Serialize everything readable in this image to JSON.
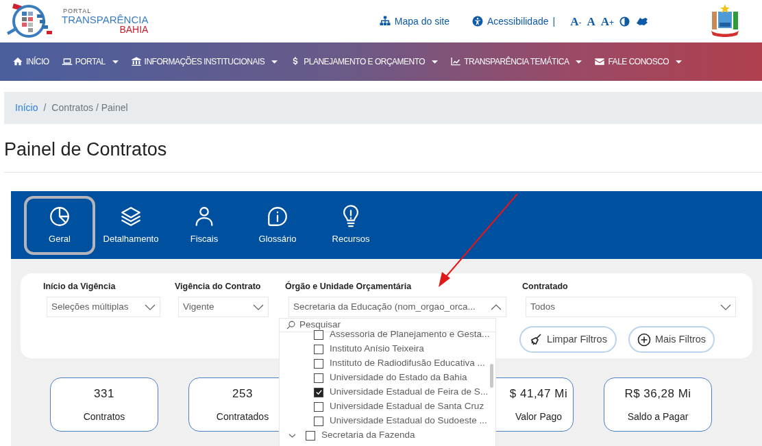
{
  "header": {
    "logo": {
      "small": "PORTAL",
      "name": "TRANSPARÊNCIA",
      "region": "BAHIA"
    },
    "links": [
      {
        "kind": "sitemap",
        "label": "Mapa do site"
      },
      {
        "kind": "accessibility",
        "label": "Acessibilidade"
      }
    ],
    "separator": "|",
    "font_controls": [
      {
        "letter": "A",
        "sign": "-"
      },
      {
        "letter": "A"
      },
      {
        "letter": "A",
        "sign": "+"
      }
    ]
  },
  "nav": [
    {
      "label": "INÍCIO",
      "dropdown": false
    },
    {
      "label": "PORTAL",
      "dropdown": true
    },
    {
      "label": "INFORMAÇÕES INSTITUCIONAIS",
      "dropdown": true
    },
    {
      "label": "PLANEJAMENTO E ORÇAMENTO",
      "dropdown": true
    },
    {
      "label": "TRANSPARÊNCIA TEMÁTICA",
      "dropdown": true
    },
    {
      "label": "FALE CONOSCO",
      "dropdown": true
    }
  ],
  "breadcrumb": [
    {
      "label": "Início",
      "link": true
    },
    {
      "label": "/",
      "link": false
    },
    {
      "label": "Contratos / Painel",
      "link": false
    }
  ],
  "page_title": "Painel de Contratos",
  "report": {
    "tabs": [
      {
        "label": "Geral",
        "selected": true
      },
      {
        "label": "Detalhamento",
        "selected": false
      },
      {
        "label": "Fiscais",
        "selected": false
      },
      {
        "label": "Glossário",
        "selected": false
      },
      {
        "label": "Recursos",
        "selected": false
      }
    ],
    "filters": [
      {
        "label": "Início da Vigência",
        "value": "Seleções múltiplas",
        "open": false
      },
      {
        "label": "Vigência do Contrato",
        "value": "Vigente",
        "open": false
      },
      {
        "label": "Órgão e Unidade Orçamentária",
        "value": "Secretaria da Educação (nom_orgao_orca...",
        "open": true
      },
      {
        "label": "Contratado",
        "value": "Todos",
        "open": false
      }
    ],
    "dropdown": {
      "placeholder": "Pesquisar",
      "items": [
        {
          "children": [
            {
              "label": "Assessoria de Planejamento e Gesta...",
              "checked": false
            },
            {
              "label": "Instituto Anísio Teixeira",
              "checked": false
            },
            {
              "label": "Instituto de Radiodifusão Educativa ...",
              "checked": false
            },
            {
              "label": "Universidade do Estado da Bahia",
              "checked": false
            },
            {
              "label": "Universidade Estadual de Feira de S...",
              "checked": true
            },
            {
              "label": "Universidade Estadual de Santa Cruz",
              "checked": false
            },
            {
              "label": "Universidade Estadual do Sudoeste ...",
              "checked": false
            }
          ]
        },
        {
          "label": "Secretaria da Fazenda",
          "checked": false
        }
      ]
    },
    "buttons": [
      "Limpar Filtros",
      "Mais Filtros"
    ],
    "cards": [
      {
        "value": "331",
        "label": "Contratos"
      },
      {
        "value": "253",
        "label": "Contratados"
      },
      {
        "value": "$ 41,47 Mi",
        "label": "Valor Pago"
      },
      {
        "value": "R$ 36,28 Mi",
        "label": "Saldo a Pagar"
      }
    ]
  }
}
